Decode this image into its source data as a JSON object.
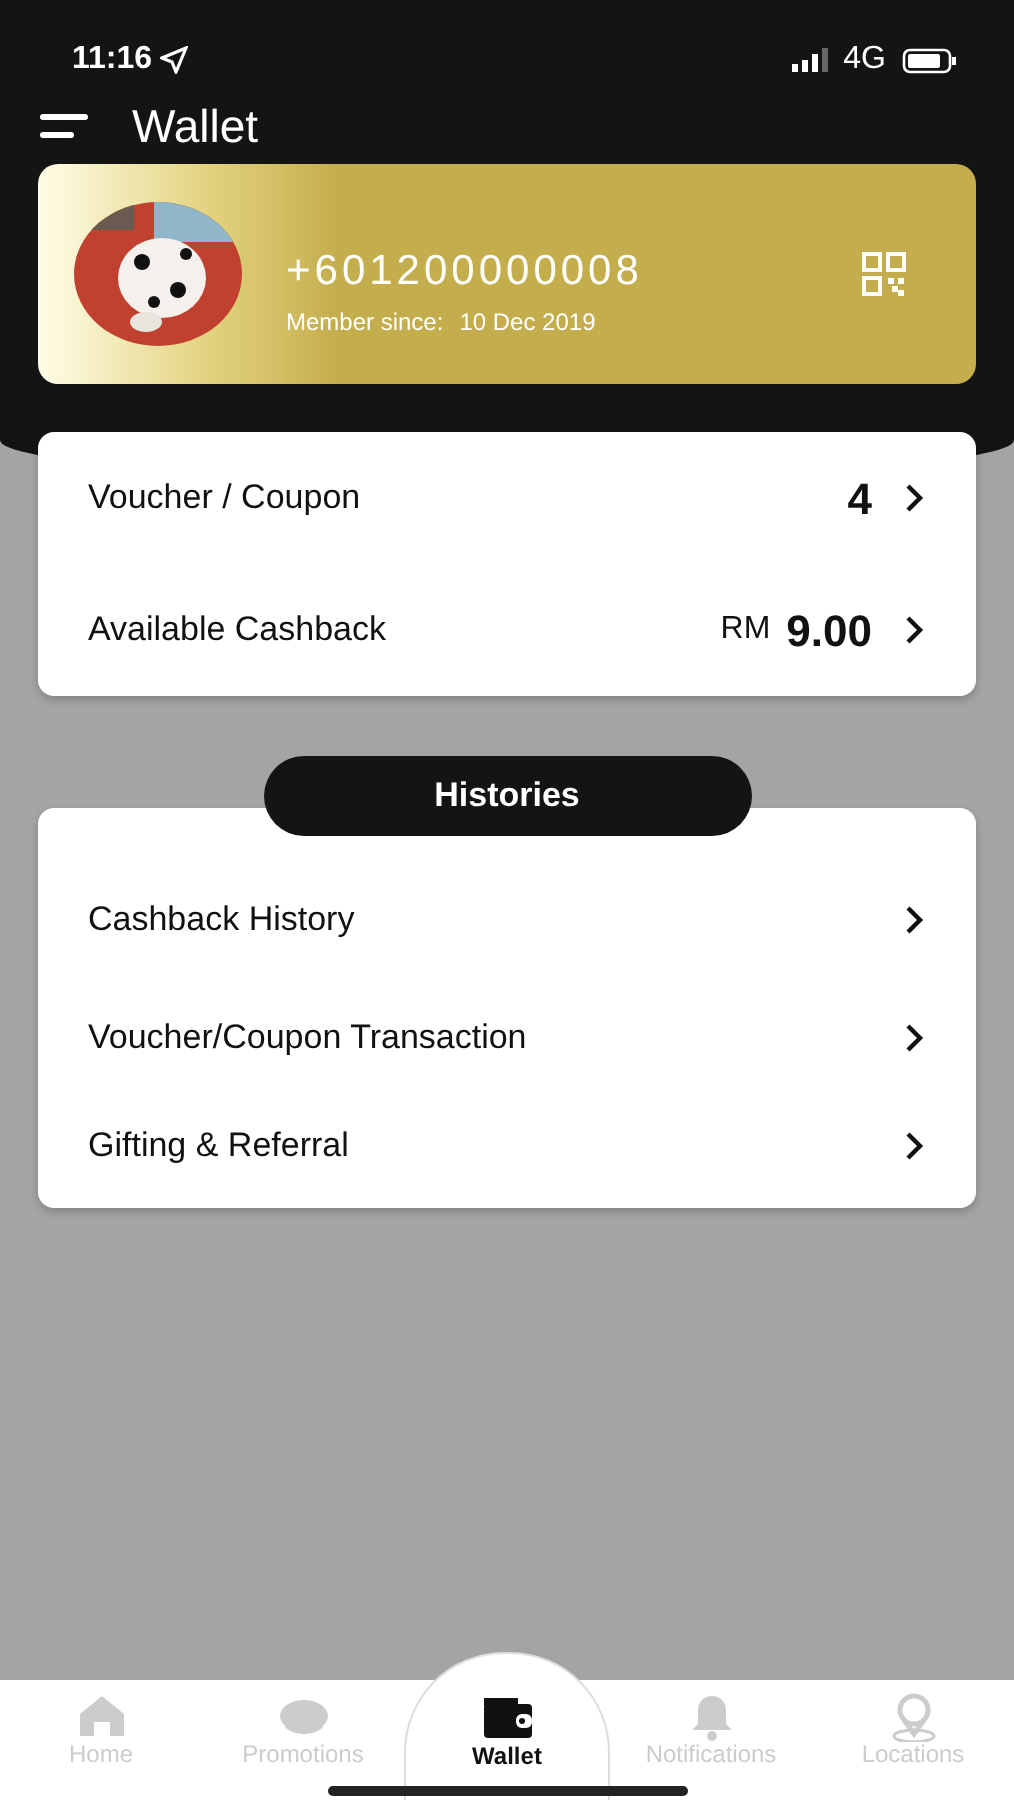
{
  "status_bar": {
    "time": "11:16",
    "network": "4G"
  },
  "header": {
    "title": "Wallet"
  },
  "member_card": {
    "phone": "+601200000008",
    "member_since_label": "Member since:",
    "member_since": "10 Dec 2019"
  },
  "summary": [
    {
      "label": "Voucher / Coupon",
      "value": "4"
    },
    {
      "label": "Available Cashback",
      "prefix": "RM",
      "value": "9.00"
    }
  ],
  "histories": {
    "title": "Histories",
    "items": [
      "Cashback History",
      "Voucher/Coupon Transaction",
      "Gifting & Referral"
    ]
  },
  "tab_bar": [
    {
      "kind": "home",
      "label": "Home",
      "selected": false
    },
    {
      "kind": "promotions",
      "label": "Promotions",
      "selected": false
    },
    {
      "kind": "wallet",
      "label": "Wallet",
      "selected": true
    },
    {
      "kind": "notifications",
      "label": "Notifications",
      "selected": false
    },
    {
      "kind": "locations",
      "label": "Locations",
      "selected": false
    }
  ]
}
